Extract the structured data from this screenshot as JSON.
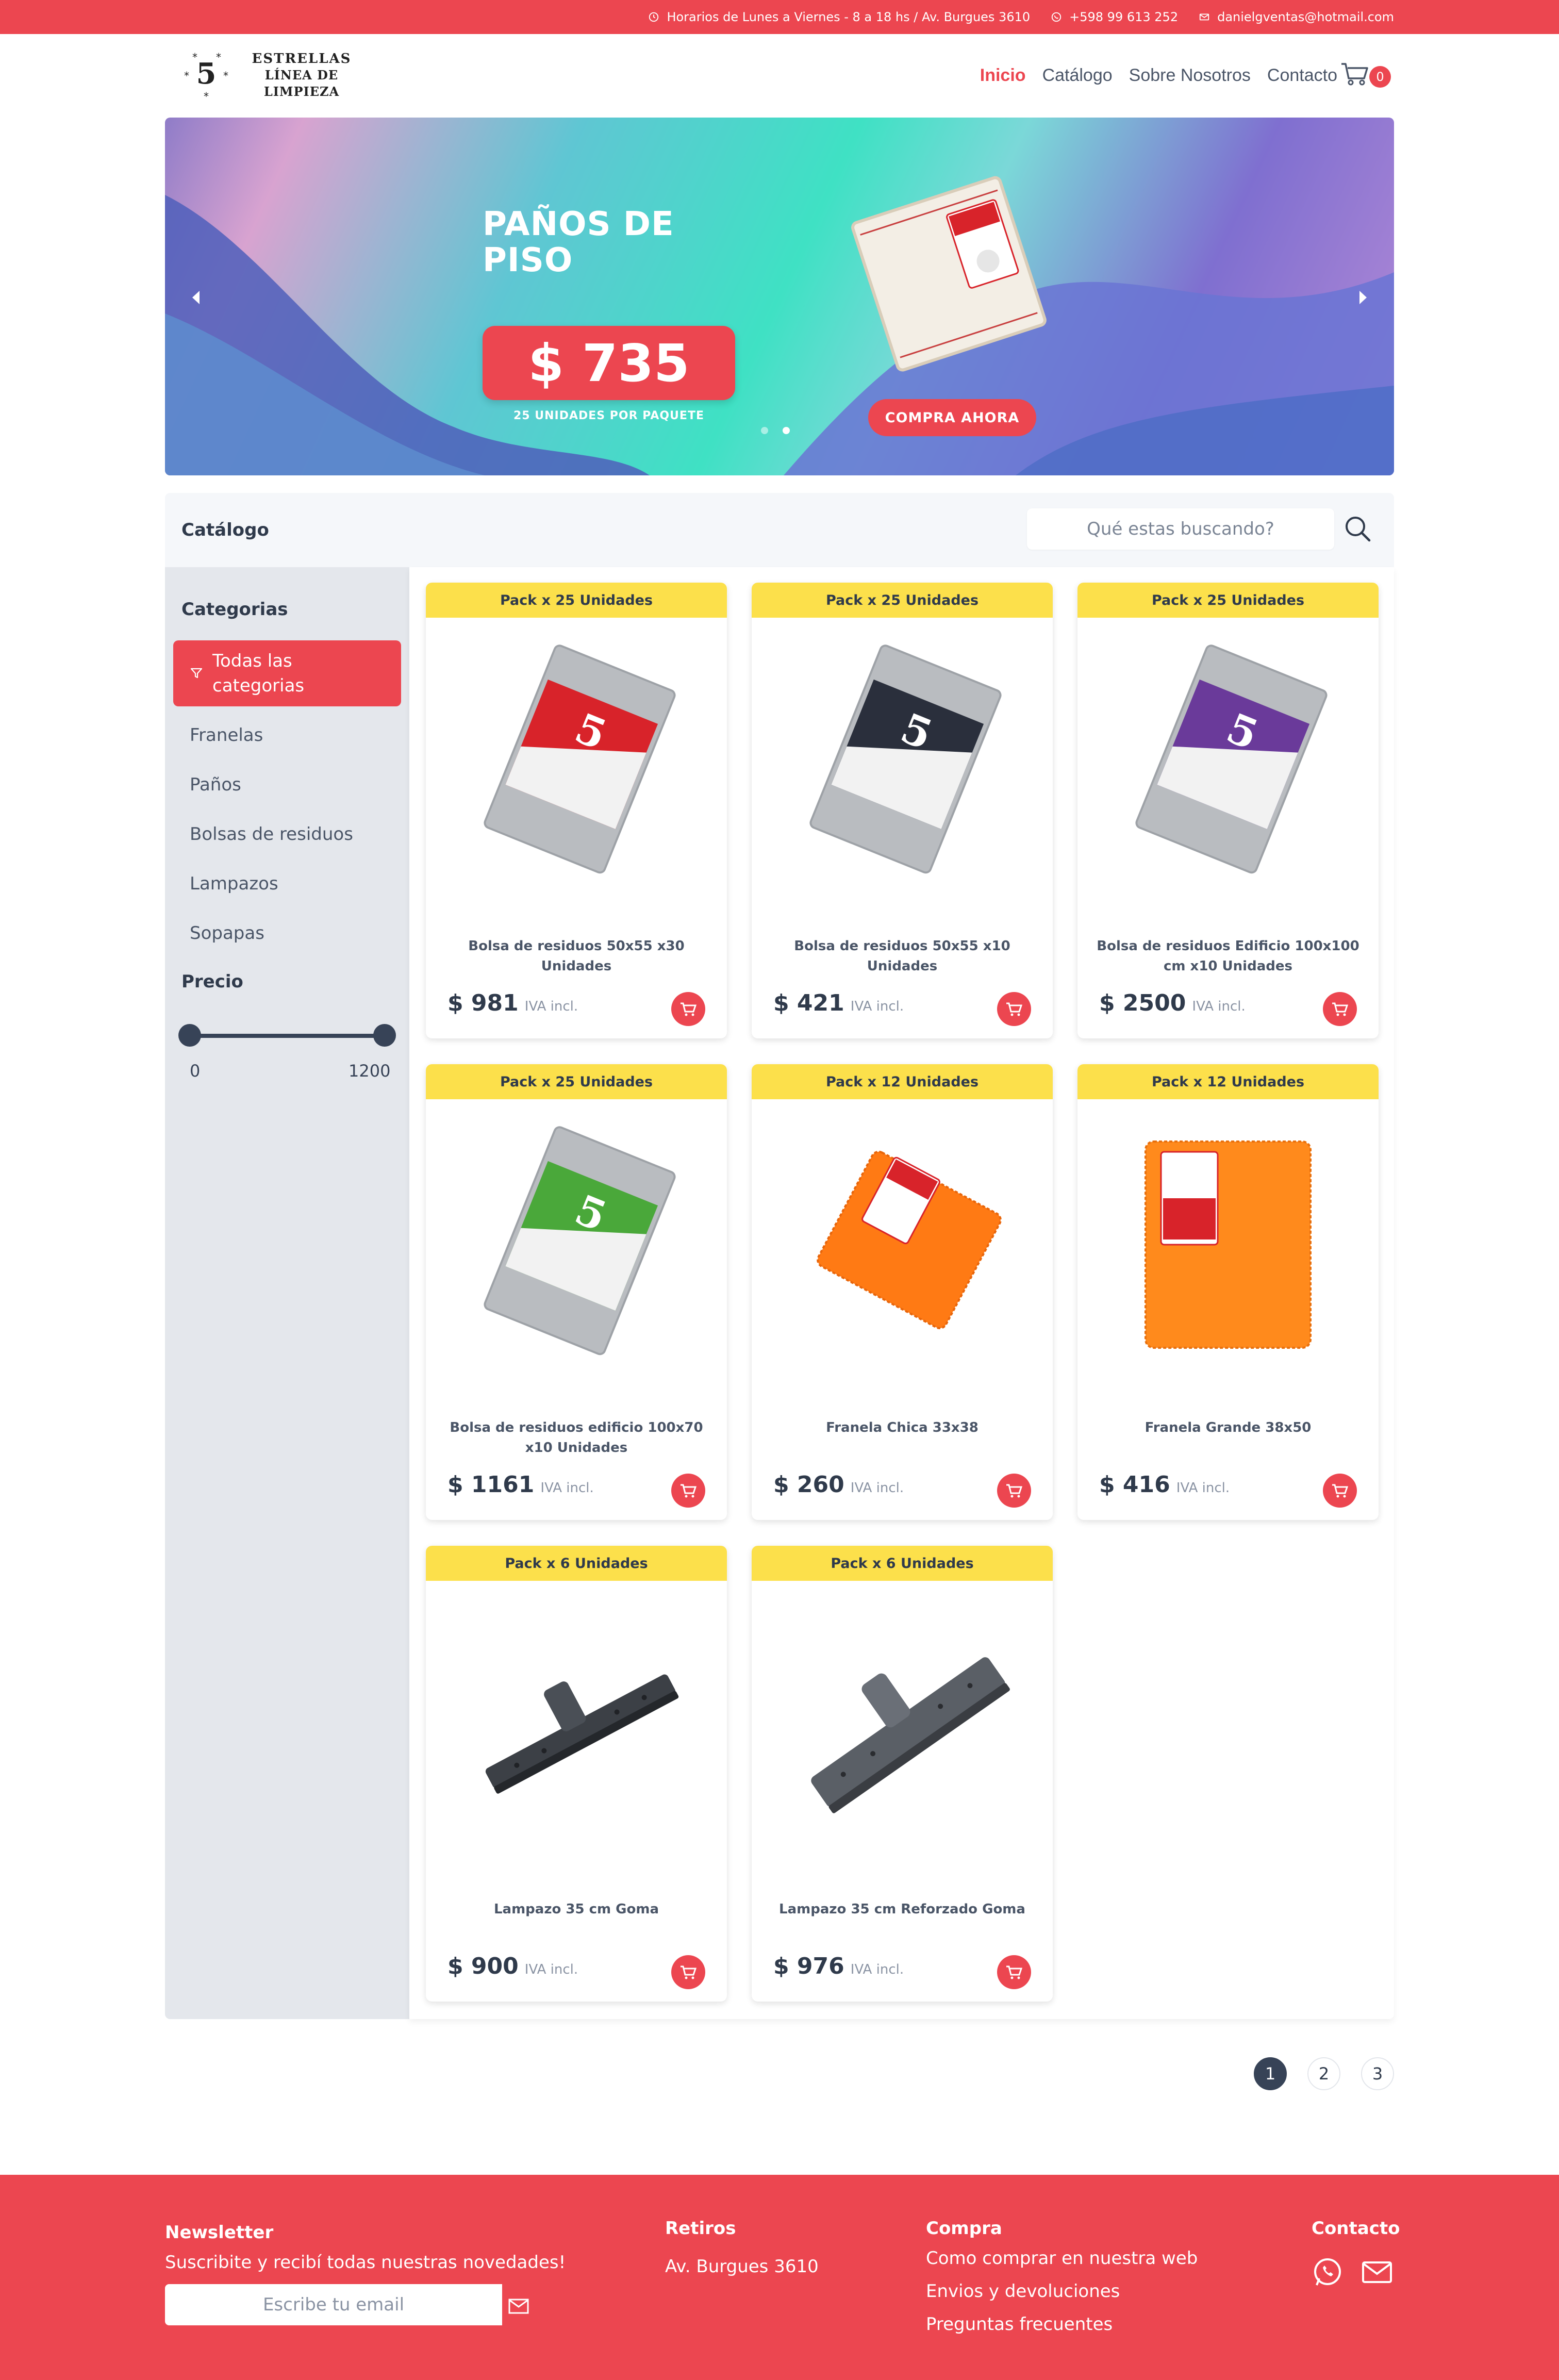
{
  "topbar": {
    "hours": "Horarios de Lunes a Viernes - 8 a 18 hs / Av. Burgues 3610",
    "phone": "+598 99 613 252",
    "email": "danielgventas@hotmail.com",
    "bg_color": "#ec4650"
  },
  "brand": {
    "mark": "5",
    "name_line1": "ESTRELLAS",
    "name_line2": "LÍNEA  DE LIMPIEZA"
  },
  "nav": {
    "items": [
      "Inicio",
      "Catálogo",
      "Sobre Nosotros",
      "Contacto"
    ],
    "active": "Inicio",
    "cart_count": "0"
  },
  "hero": {
    "title_line1": "PAÑOS DE",
    "title_line2": "PISO",
    "price": "$ 735",
    "subtitle": "25 UNIDADES POR PAQUETE",
    "cta": "COMPRA AHORA",
    "slides": 2,
    "active_slide": 2
  },
  "catalog": {
    "title": "Catálogo",
    "search_placeholder": "Qué estas buscando?"
  },
  "sidebar": {
    "categories_title": "Categorias",
    "active_category": "Todas las categorias",
    "categories": [
      "Franelas",
      "Paños",
      "Bolsas de residuos",
      "Lampazos",
      "Sopapas"
    ],
    "price_title": "Precio",
    "price_min": "0",
    "price_max": "1200"
  },
  "products": [
    {
      "badge": "Pack x 25 Unidades",
      "name": "Bolsa de residuos 50x55 x30 Unidades",
      "price": "$ 981",
      "iva": "IVA incl.",
      "image": "bag-red-icon",
      "color": "#d8232a"
    },
    {
      "badge": "Pack x 25 Unidades",
      "name": "Bolsa de residuos 50x55 x10 Unidades",
      "price": "$ 421",
      "iva": "IVA incl.",
      "image": "bag-black-icon",
      "color": "#2a2f3c"
    },
    {
      "badge": "Pack x 25 Unidades",
      "name": "Bolsa de residuos Edificio 100x100 cm x10 Unidades",
      "price": "$ 2500",
      "iva": "IVA incl.",
      "image": "bag-purple-icon",
      "color": "#6a3a9a"
    },
    {
      "badge": "Pack x 25 Unidades",
      "name": "Bolsa de residuos edificio 100x70 x10 Unidades",
      "price": "$ 1161",
      "iva": "IVA incl.",
      "image": "bag-green-icon",
      "color": "#4aa83a"
    },
    {
      "badge": "Pack x 12 Unidades",
      "name": "Franela Chica 33x38",
      "price": "$ 260",
      "iva": "IVA incl.",
      "image": "cloth-small-icon",
      "color": "#ff7a14"
    },
    {
      "badge": "Pack x 12 Unidades",
      "name": "Franela Grande 38x50",
      "price": "$ 416",
      "iva": "IVA incl.",
      "image": "cloth-large-icon",
      "color": "#ff8a1c"
    },
    {
      "badge": "Pack x 6 Unidades",
      "name": "Lampazo 35 cm Goma",
      "price": "$ 900",
      "iva": "IVA incl.",
      "image": "squeegee-icon",
      "color": "#3c4046"
    },
    {
      "badge": "Pack x 6 Unidades",
      "name": "Lampazo 35 cm Reforzado Goma",
      "price": "$ 976",
      "iva": "IVA incl.",
      "image": "squeegee-reinforced-icon",
      "color": "#5a5f66"
    }
  ],
  "pagination": {
    "pages": [
      "1",
      "2",
      "3"
    ],
    "current": "1"
  },
  "footer": {
    "newsletter_title": "Newsletter",
    "newsletter_text": "Suscribite y recibí todas nuestras novedades!",
    "newsletter_placeholder": "Escribe tu email",
    "pickup_title": "Retiros",
    "pickup_address": "Av. Burgues 3610",
    "buy_title": "Compra",
    "buy_links": [
      "Como comprar en nuestra web",
      "Envios y devoluciones",
      "Preguntas frecuentes"
    ],
    "contact_title": "Contacto",
    "contact_icons": [
      "whatsapp-icon",
      "mail-icon"
    ]
  }
}
